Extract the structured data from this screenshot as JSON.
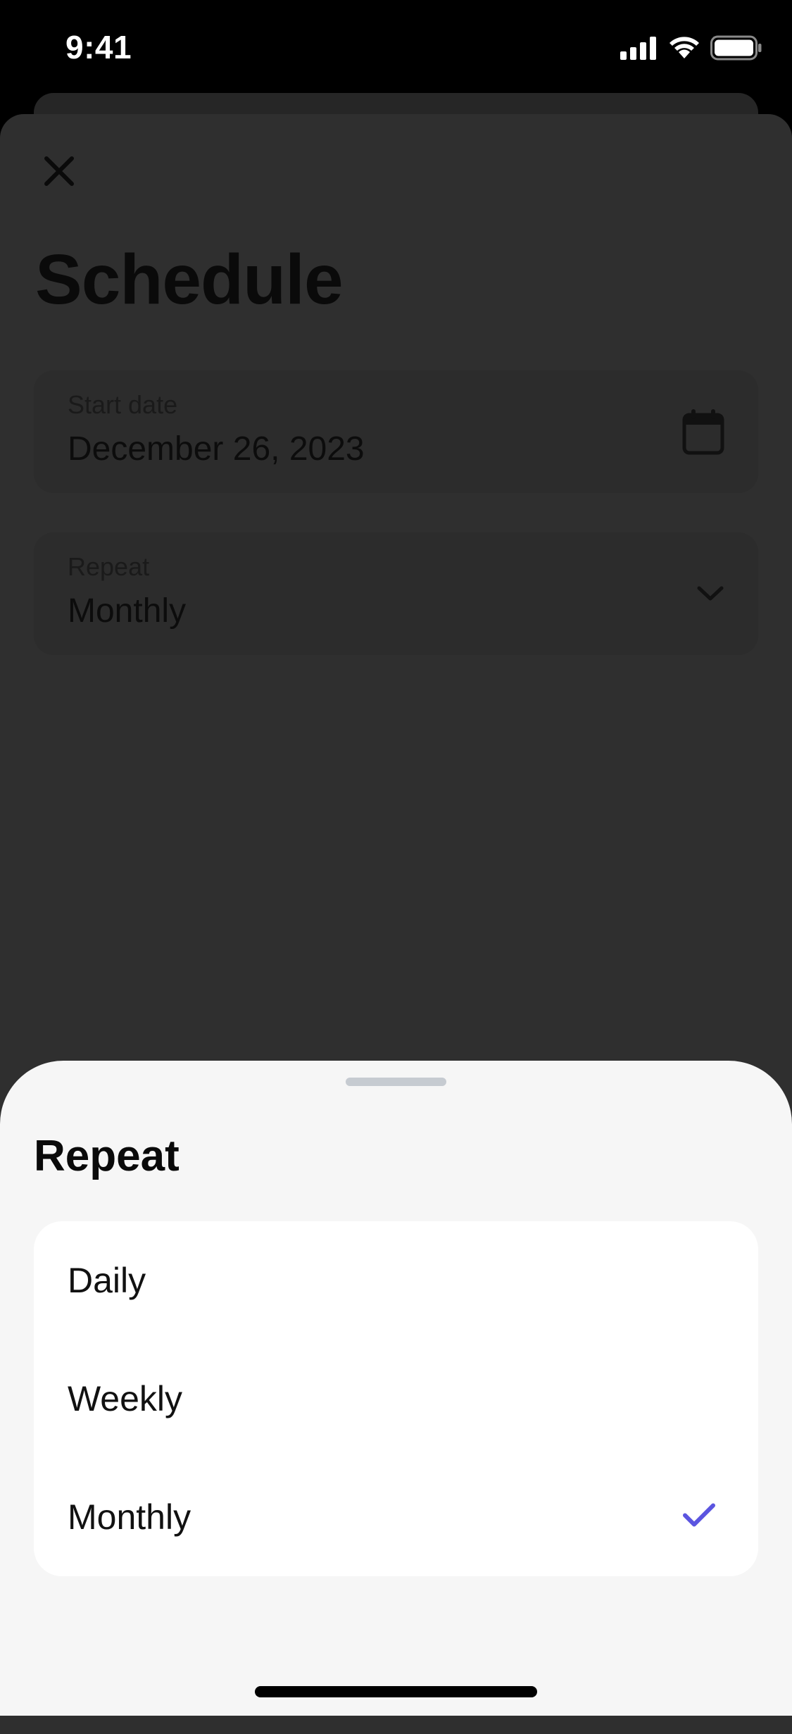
{
  "status_bar": {
    "time": "9:41"
  },
  "page": {
    "title": "Schedule",
    "close_icon": "close-icon"
  },
  "fields": {
    "start_date": {
      "label": "Start date",
      "value": "December 26, 2023",
      "icon": "calendar-icon"
    },
    "repeat": {
      "label": "Repeat",
      "value": "Monthly",
      "icon": "chevron-down-icon"
    }
  },
  "repeat_sheet": {
    "title": "Repeat",
    "options": [
      {
        "label": "Daily",
        "selected": false
      },
      {
        "label": "Weekly",
        "selected": false
      },
      {
        "label": "Monthly",
        "selected": true
      }
    ],
    "check_icon": "checkmark-icon"
  },
  "colors": {
    "accent": "#5b55e0",
    "overlay_background": "#2f2f2f",
    "sheet_background": "#f6f6f6",
    "card_background": "#ffffff"
  }
}
